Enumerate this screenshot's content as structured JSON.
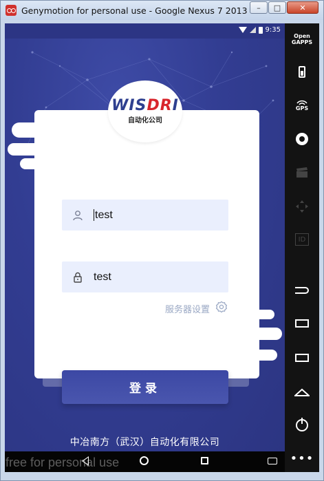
{
  "window": {
    "title": "Genymotion for personal use - Google Nexus 7 2013 - ...",
    "min_label": "–",
    "max_label": "□",
    "close_label": "✕"
  },
  "status_bar": {
    "time": "9:35"
  },
  "logo": {
    "brand": "WISDRI",
    "subtitle": "自动化公司"
  },
  "login": {
    "username_value": "test",
    "password_value": "test",
    "server_settings_label": "服务器设置",
    "submit_label": "登录"
  },
  "footer": {
    "company": "中冶南方（武汉）自动化有限公司"
  },
  "watermark": "free for personal use",
  "side_panel": {
    "gapps_label": "Open\nGAPPS",
    "gps_label": "GPS",
    "id_label": "ID"
  },
  "colors": {
    "background": "#323d92",
    "field_bg": "#eaeffd",
    "button": "#4350a8",
    "brand_blue": "#2e3f8f",
    "brand_red": "#d8262d"
  },
  "icons": [
    "user-icon",
    "lock-icon",
    "gear-icon",
    "wifi-icon",
    "signal-icon",
    "battery-icon",
    "back-icon",
    "home-icon",
    "recent-apps-icon",
    "keyboard-icon",
    "camera-icon",
    "power-icon",
    "menu-dots-icon"
  ]
}
